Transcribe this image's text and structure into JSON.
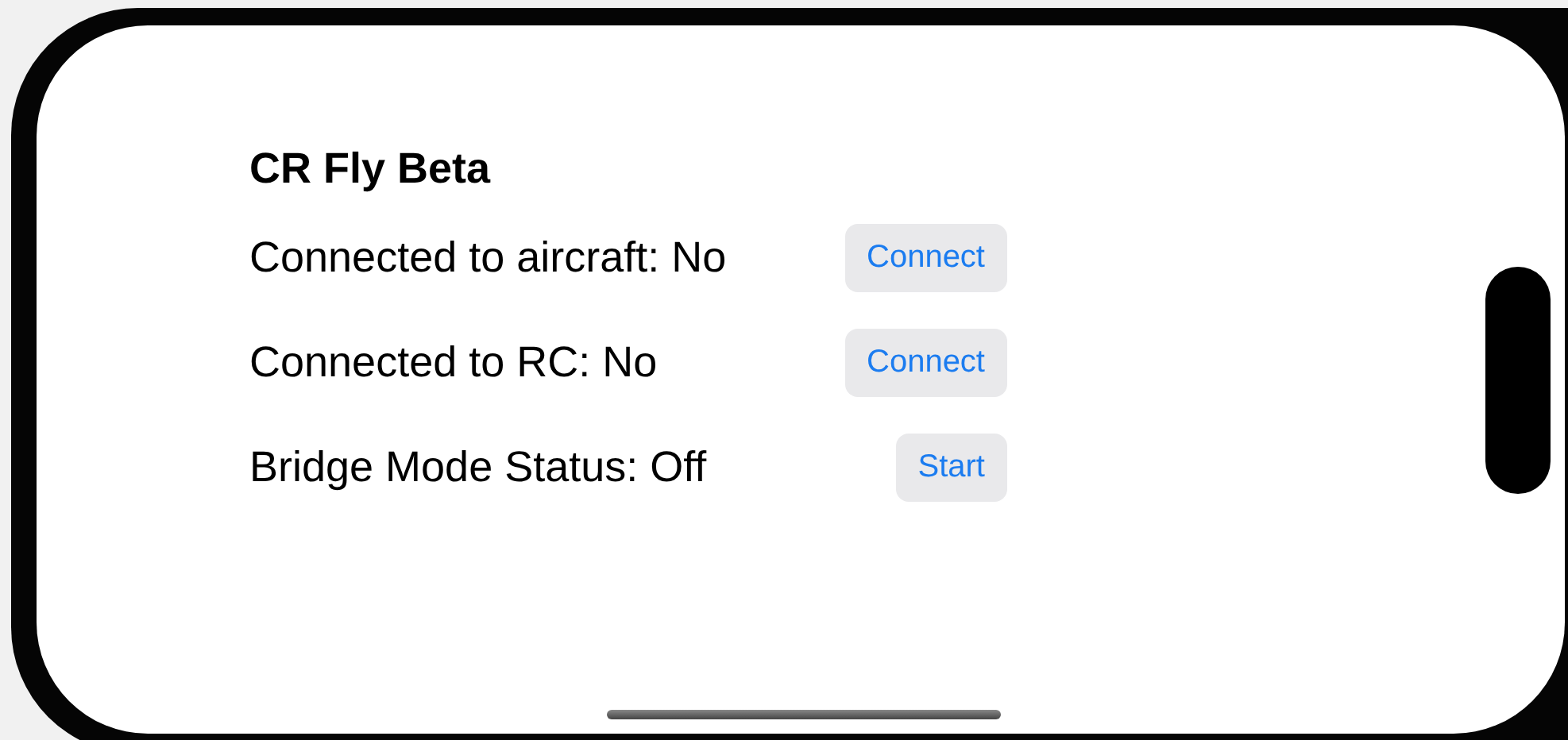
{
  "app_title": "CR Fly Beta",
  "rows": [
    {
      "label": "Connected to aircraft: No",
      "button": "Connect"
    },
    {
      "label": "Connected to RC: No",
      "button": "Connect"
    },
    {
      "label": "Bridge Mode Status: Off",
      "button": "Start"
    }
  ]
}
